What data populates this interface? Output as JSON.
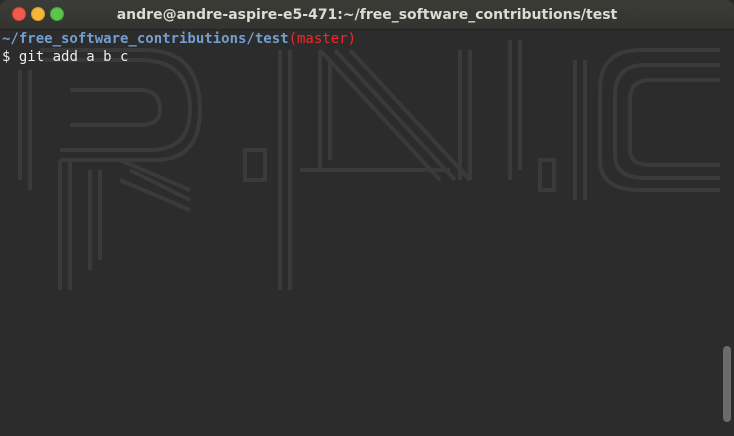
{
  "window": {
    "title": "andre@andre-aspire-e5-471:~/free_software_contributions/test"
  },
  "terminal": {
    "prompt_path": "~/free_software_contributions/test",
    "prompt_branch": "(master)",
    "prompt_symbol": "$",
    "command": "git add a b c"
  },
  "colors": {
    "path": "#729fcf",
    "branch": "#ef2929",
    "text": "#eeeeec",
    "background": "#2c2c2c"
  }
}
